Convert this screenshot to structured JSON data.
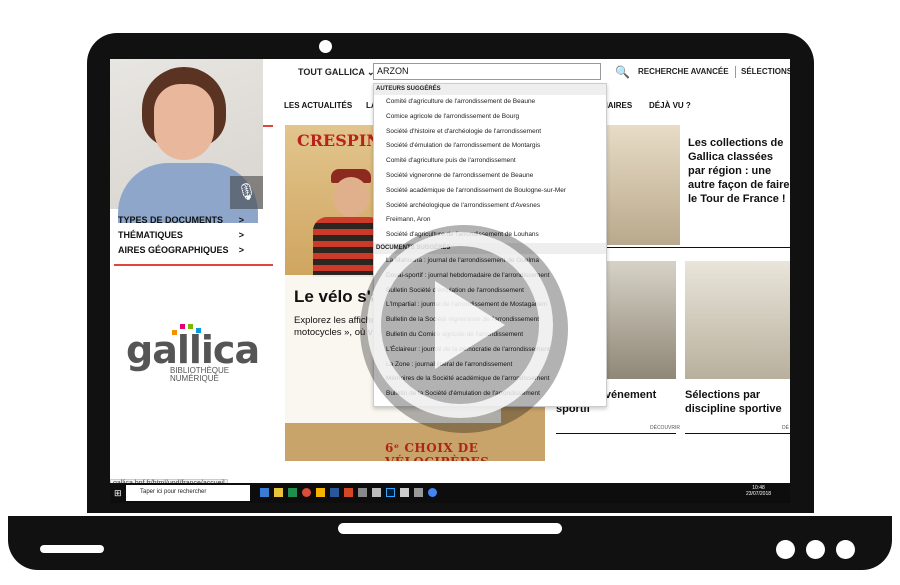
{
  "search": {
    "scope_label": "TOUT GALLICA ⌄",
    "query": "ARZON",
    "advanced_label": "RECHERCHE AVANCÉE",
    "selections_label": "SÉLECTIONS"
  },
  "nav": {
    "actualites": "LES ACTUALITÉS",
    "la": "LA",
    "dictionnaires": "NAIRES",
    "deja_vu": "DÉJÀ VU ?"
  },
  "sidebar": {
    "items": [
      {
        "label": "TYPES DE DOCUMENTS",
        "chevron": ">"
      },
      {
        "label": "THÉMATIQUES",
        "chevron": ">"
      },
      {
        "label": "AIRES GÉOGRAPHIQUES",
        "chevron": ">"
      }
    ]
  },
  "logo": {
    "word": "gallica",
    "line1": "BIBLIOTHÈQUE",
    "line2": "NUMÉRIQUE",
    "colors": [
      "#e2007a",
      "#7ab800",
      "#009ee0",
      "#f39200"
    ]
  },
  "status_url": "gallica.bnf.fr/html/und/france/accueil",
  "hero": {
    "poster_brand": "CRESPIN",
    "poster_brand_small": "AINÉ",
    "title": "Le vélo s'a",
    "text": "Explorez les affiche thème. Un exemple motocycles », où vo de vélocipèdes !",
    "poster_caption": "6ᵉ CHOIX DE VÉLOCIPÈDES"
  },
  "right": {
    "collections_title": "Les collections de Gallica classées par région : une autre façon de faire le Tour de France !",
    "event_title": "ons par événement sportif",
    "discipline_title": "Sélections par discipline sportive",
    "discover_label": "DÉCOUVRIR",
    "discover_short": "DÉ"
  },
  "dropdown": {
    "authors_header": "AUTEURS SUGGÉRÉS",
    "authors": [
      "Comité d'agriculture de l'arrondissement de Beaune",
      "Comice agricole de l'arrondissement de Bourg",
      "Société d'histoire et d'archéologie de l'arrondissement",
      "Société d'émulation de l'arrondissement de Montargis",
      "Comité d'agriculture puis de l'arrondissement",
      "Société vigneronne de l'arrondissement de Beaune",
      "Société académique de l'arrondissement de Boulogne-sur-Mer",
      "Société archéologique de l'arrondissement d'Avesnes",
      "Freimann, Aron",
      "Société d'agriculture de l'arrondissement de Louhans"
    ],
    "documents_header": "DOCUMENTS SUGGÉRÉS",
    "documents": [
      "La Mahouna : journal de l'arrondissement de Guelma",
      "Douai-sportif : journal hebdomadaire de l'arrondissement",
      "Bulletin Société d'émulation de l'arrondissement",
      "L'Impartial : journal de l'arrondissement de Mostaganem",
      "Bulletin de la Société vigneronne de l'arrondissement",
      "Bulletin du Comice agricole de l'arrondissement",
      "L'Éclaireur : journal de la démocratie de l'arrondissement",
      "La Zone : journal libéral de l'arrondissement",
      "Mémoires de la Société académique de l'arrondissement",
      "Bulletin de la Société d'émulation de l'arrondissement"
    ]
  },
  "taskbar": {
    "start_icon": "⊞",
    "search_placeholder": "Taper ici pour rechercher",
    "time": "10:48",
    "date": "23/07/2018"
  },
  "icons": {
    "mic": "🎙",
    "search": "🔍",
    "play": "play-icon"
  }
}
